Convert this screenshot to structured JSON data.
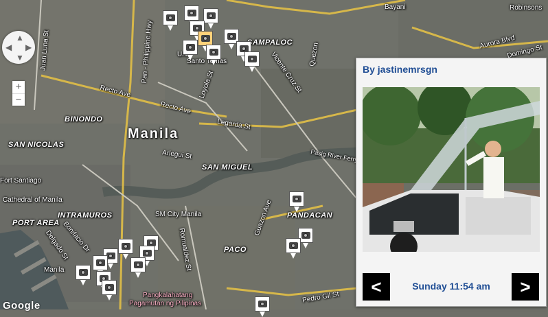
{
  "map": {
    "labels": {
      "bayani": "Bayani",
      "robinsons": "Robinsons",
      "sampaloc": "SAMPALOC",
      "aurora_blvd": "Aurora Blvd",
      "domingo_st": "Domingo St",
      "quezon": "Quezon",
      "vicente_cruz": "Vicente Cruz St",
      "santo_tomas": "Santo Tomas",
      "univ": "Uni",
      "juan_luna": "Juan Luna St",
      "ph_hwy": "Pan - Philippine Hwy",
      "recto": "Recto Ave",
      "recto2": "Recto Ave",
      "loyola": "Loyola St",
      "binondo": "BINONDO",
      "manila": "Manila",
      "legarda": "Legarda St",
      "san_nicolas": "SAN NICOLAS",
      "arlegui": "Arlegui St",
      "san_miguel": "SAN MIGUEL",
      "pasig": "Pasig River Ferry",
      "fort_santiago": "Fort Santiago",
      "cathedral": "Cathedral of Manila",
      "intramuros": "INTRAMUROS",
      "sm_city": "SM City Manila",
      "port_area": "PORT AREA",
      "bonifacio": "Bonifacio Dr",
      "delgado": "Delgado St",
      "guazon": "Guazon Ave",
      "pandacan": "PANDACAN",
      "romualdez": "Romualdez St",
      "paco": "PACO",
      "manila_small": "Manila",
      "pangkalahatang": "Pangkalahatang",
      "pagamutan": "Pagamutan ng Pilipinas",
      "pedro_gil": "Pedro Gil St",
      "google": "Google"
    },
    "controls": {
      "zoom_in": "+",
      "zoom_out": "−"
    }
  },
  "panel": {
    "author": "By jastinemrsgn",
    "time": "Sunday 11:54 am",
    "prev": "<",
    "next": ">"
  }
}
